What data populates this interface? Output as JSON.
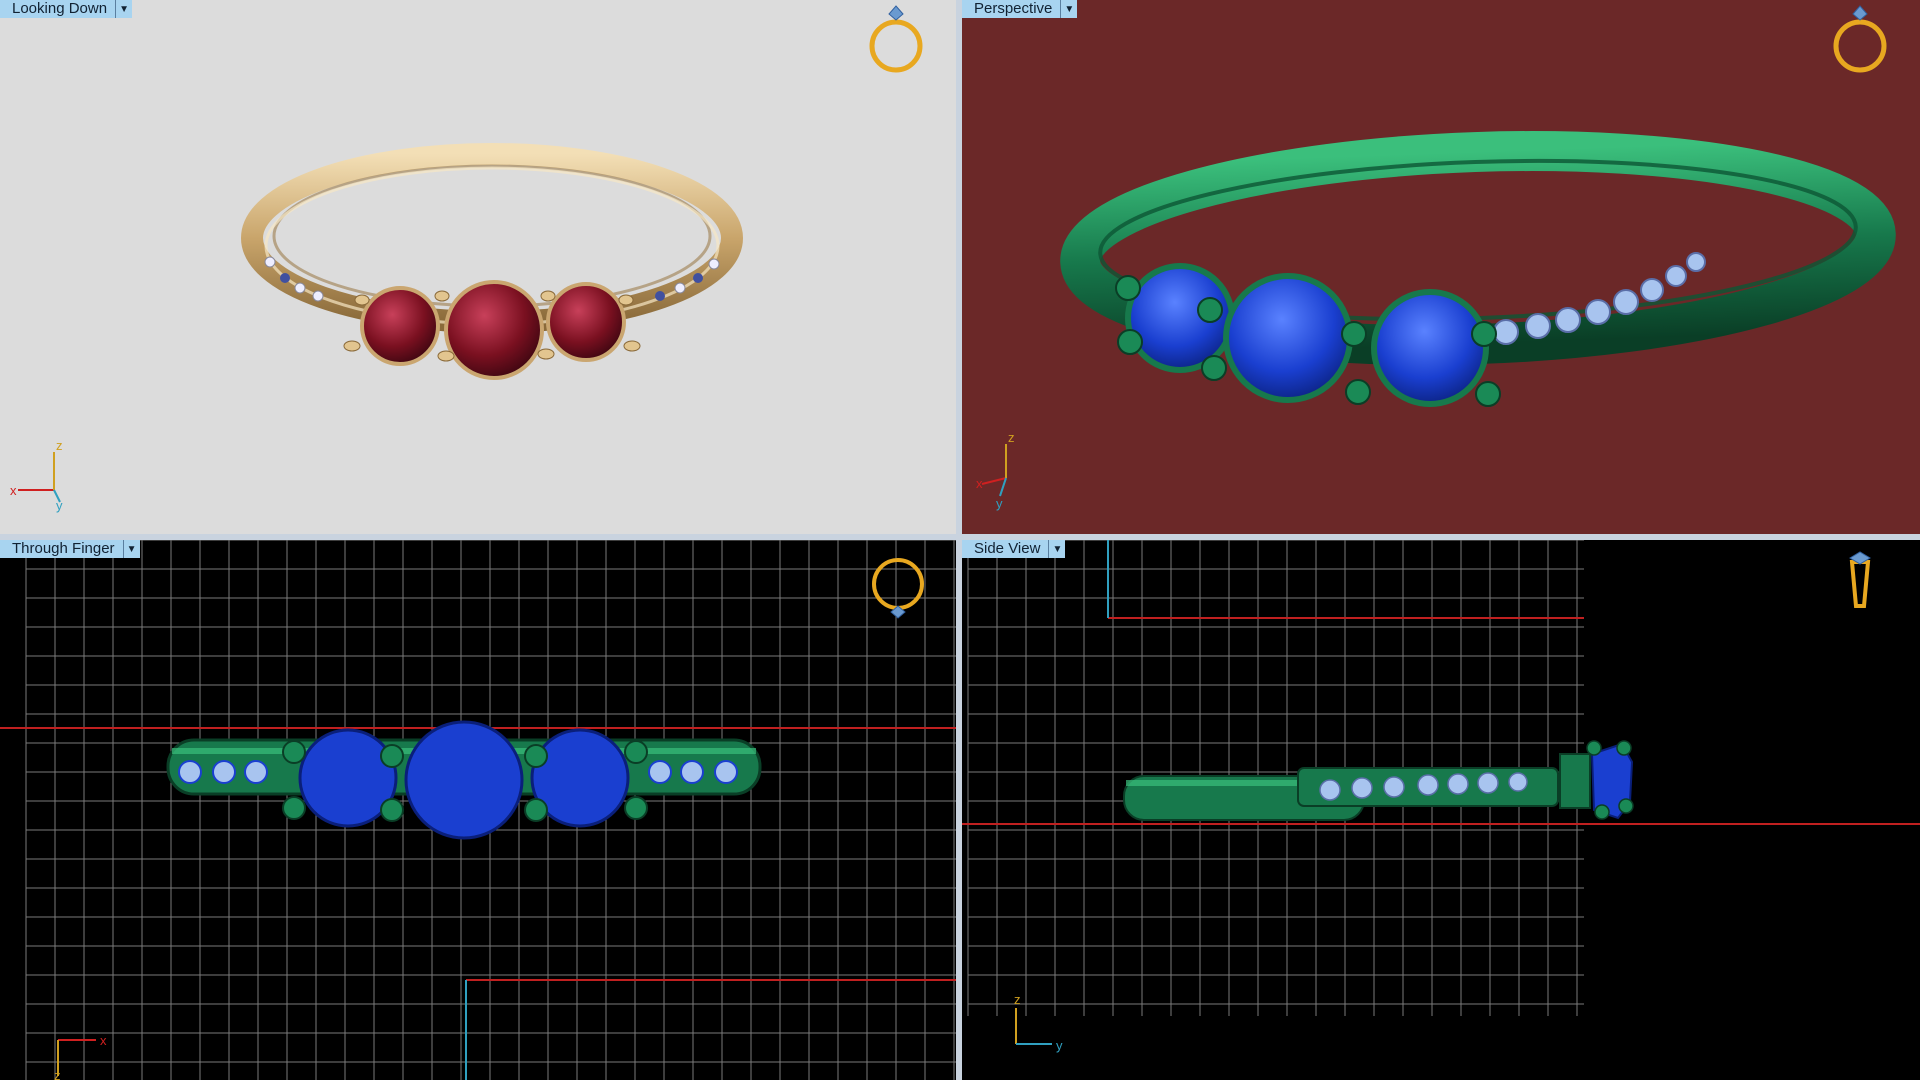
{
  "viewports": {
    "top_left": {
      "label": "Looking Down",
      "bg": "#dcdcdc"
    },
    "top_right": {
      "label": "Perspective",
      "bg": "#6b2828"
    },
    "bottom_left": {
      "label": "Through Finger",
      "bg": "#000000"
    },
    "bottom_right": {
      "label": "Side View",
      "bg": "#000000"
    }
  },
  "axes": {
    "top_left": {
      "x": "x",
      "y": "y",
      "z": "z"
    },
    "top_right": {
      "x": "x",
      "y": "y",
      "z": "z"
    },
    "bottom_left": {
      "x": "x",
      "z": "z"
    },
    "bottom_right": {
      "y": "y",
      "z": "z"
    }
  },
  "colors": {
    "gold": "#d9b77e",
    "ruby": "#7a1020",
    "sapphire": "#1a3fd0",
    "green_metal": "#17794c",
    "diamond": "#a8c4ef",
    "grid_line": "#7a7a7a",
    "construction_red": "#c02020",
    "axis_x": "#d02020",
    "axis_y": "#30a0c0",
    "axis_z": "#d0a020",
    "divider": "#c9d3df",
    "label_bg": "#a8d4f0"
  },
  "icons": {
    "view_cube": "ring-orientation-icon",
    "dropdown": "dropdown-arrow-icon"
  }
}
